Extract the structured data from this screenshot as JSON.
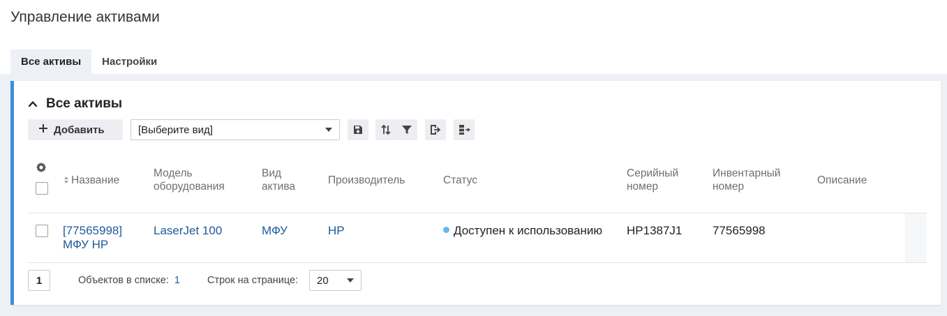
{
  "page": {
    "title": "Управление активами"
  },
  "tabs": [
    {
      "label": "Все активы",
      "active": true
    },
    {
      "label": "Настройки",
      "active": false
    }
  ],
  "panel": {
    "title": "Все активы",
    "toolbar": {
      "add_label": "Добавить",
      "view_select_value": "[Выберите вид]",
      "icons": [
        "save-icon",
        "sort-icon",
        "filter-icon",
        "export-icon",
        "columns-export-icon"
      ]
    }
  },
  "table": {
    "columns": {
      "name": "Название",
      "model": "Модель оборудования",
      "type": "Вид актива",
      "manufacturer": "Производитель",
      "status": "Статус",
      "serial": "Серийный номер",
      "inventory": "Инвентарный номер",
      "description": "Описание"
    },
    "rows": [
      {
        "name_line1": "[77565998]",
        "name_line2": "МФУ HP",
        "model": "LaserJet 100",
        "type": "МФУ",
        "manufacturer": "HP",
        "status": "Доступен к использованию",
        "serial": "HP1387J1",
        "inventory": "77565998",
        "description": ""
      }
    ]
  },
  "footer": {
    "page": "1",
    "count_label": "Объектов в списке:",
    "count_value": "1",
    "rows_label": "Строк на странице:",
    "rows_value": "20"
  },
  "colors": {
    "accent": "#3f8fd6",
    "link": "#1e5a9c",
    "status_available": "#67b7ef",
    "background": "#edf1f6"
  }
}
